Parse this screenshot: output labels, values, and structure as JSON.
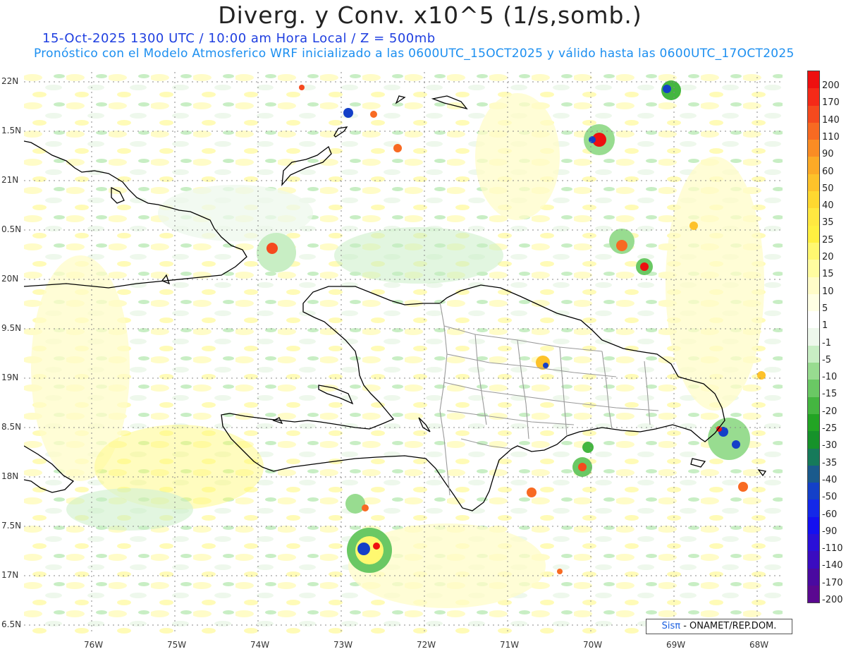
{
  "title": "Diverg. y Conv. x10^5 (1/s,somb.)",
  "subtitle_line1": "15-Oct-2025  1300 UTC / 10:00 am Hora Local / Z = 500mb",
  "subtitle_line2": "Pronóstico con el Modelo Atmosferico WRF inicializado a las 0600UTC_15OCT2025 y válido hasta las  0600UTC_17OCT2025",
  "lat_labels": [
    "22N",
    "1.5N",
    "21N",
    "0.5N",
    "20N",
    "9.5N",
    "19N",
    "8.5N",
    "18N",
    "7.5N",
    "17N",
    "6.5N"
  ],
  "lon_labels": [
    "76W",
    "75W",
    "74W",
    "73W",
    "72W",
    "71W",
    "70W",
    "69W",
    "68W"
  ],
  "legend": {
    "labels": [
      "200",
      "170",
      "140",
      "110",
      "90",
      "60",
      "50",
      "40",
      "35",
      "25",
      "20",
      "15",
      "10",
      "5",
      "1",
      "-1",
      "-5",
      "-10",
      "-15",
      "-20",
      "-25",
      "-30",
      "-35",
      "-40",
      "-50",
      "-60",
      "-90",
      "-110",
      "-140",
      "-170",
      "-200"
    ],
    "colors": [
      "#ee1010",
      "#f42a18",
      "#f54a1e",
      "#f86a22",
      "#fa8c24",
      "#fcaa26",
      "#fdc22a",
      "#fed830",
      "#ffe840",
      "#fff040",
      "#fff870",
      "#fffca0",
      "#fffcc8",
      "#ffffe4",
      "#ffffff",
      "#eef8ec",
      "#c8eec4",
      "#98dc90",
      "#6ac864",
      "#44b640",
      "#22a424",
      "#16922a",
      "#167a5a",
      "#1a5a8c",
      "#1440c8",
      "#1428e8",
      "#1410f0",
      "#2a10d8",
      "#3a0cc0",
      "#4a0aa0",
      "#5a0890"
    ]
  },
  "credit": {
    "brand": "Sisπ",
    "text": "- ONAMET/REP.DOM."
  }
}
